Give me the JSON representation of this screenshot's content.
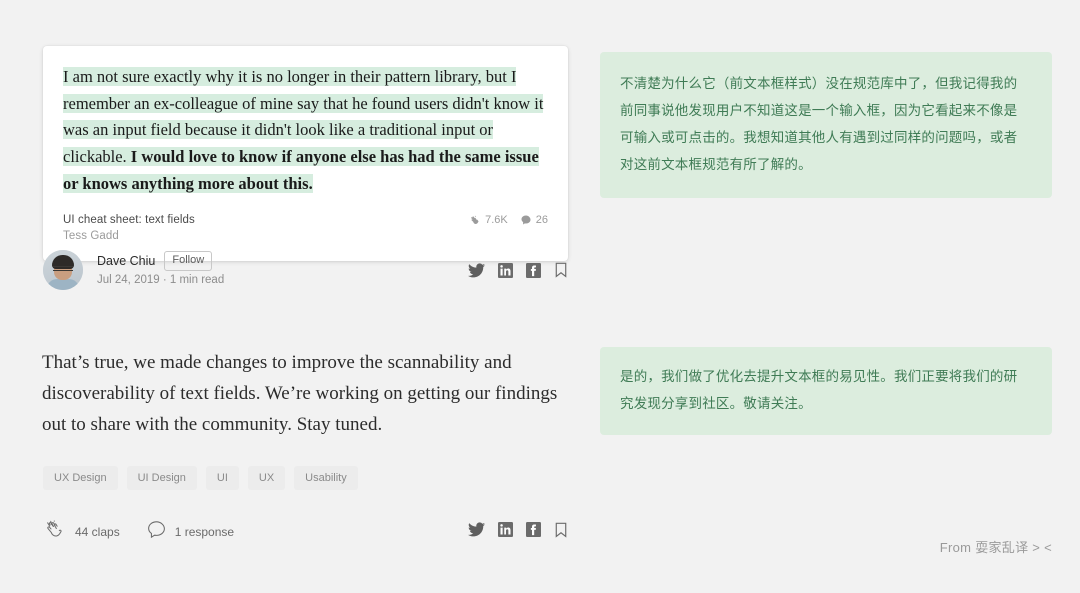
{
  "quote_card": {
    "highlight_normal_1": "I am not sure exactly why it is no longer in their pattern library, but I remember an ex-colleague of mine say that he found users didn't know it was an input field because it didn't look like a traditional input or clickable. ",
    "highlight_bold": "I would love to know if anyone else has had the same issue or knows anything more about this.",
    "source_title": "UI cheat sheet: text fields",
    "source_author": "Tess Gadd",
    "claps_count": "7.6K",
    "comments_count": "26",
    "clap_icon": "clap-icon",
    "comment_icon": "comment-bubble-icon"
  },
  "author": {
    "name": "Dave Chiu",
    "follow_label": "Follow",
    "meta": "Jul 24, 2019 · 1 min read",
    "avatar_icon": "avatar-photo"
  },
  "share": {
    "twitter_icon": "twitter-icon",
    "linkedin_icon": "linkedin-icon",
    "facebook_icon": "facebook-icon",
    "bookmark_icon": "bookmark-icon"
  },
  "body": {
    "paragraph": "That’s true, we made changes to improve the scannability and discoverability of text fields. We’re working on getting our findings out to share with the community. Stay tuned."
  },
  "tags": [
    {
      "label": "UX Design"
    },
    {
      "label": "UI Design"
    },
    {
      "label": "UI"
    },
    {
      "label": "UX"
    },
    {
      "label": "Usability"
    }
  ],
  "footer": {
    "claps_label": "44 claps",
    "responses_label": "1 response",
    "clap_icon": "clap-hands-icon",
    "response_icon": "speech-bubble-icon"
  },
  "translations": {
    "panel_1": "不清楚为什么它（前文本框样式）没在规范库中了，但我记得我的前同事说他发现用户不知道这是一个输入框，因为它看起来不像是可输入或可点击的。我想知道其他人有遇到过同样的问题吗，或者对这前文本框规范有所了解的。",
    "panel_2": "是的，我们做了优化去提升文本框的易见性。我们正要将我们的研究发现分享到社区。敬请关注。"
  },
  "credit": "From 耍家乱译 > <",
  "colors": {
    "page_bg": "#f2f2f2",
    "card_bg": "#ffffff",
    "highlight_green": "#d6eddf",
    "translation_bg": "#dcedde",
    "translation_text": "#3f7b55",
    "muted_text": "#9b9b9b",
    "tag_bg": "#ececec"
  }
}
